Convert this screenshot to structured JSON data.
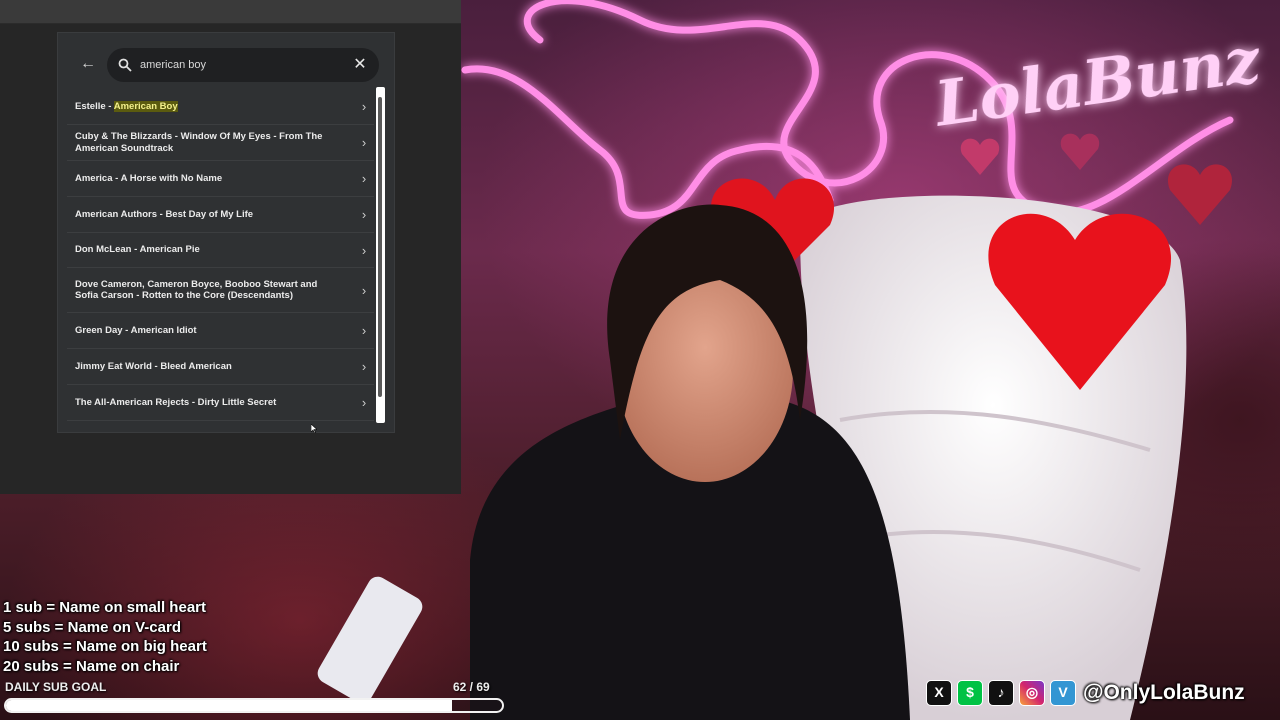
{
  "overlay": {
    "search_query": "american boy",
    "results": [
      {
        "prefix": "Estelle - ",
        "highlight": "American Boy",
        "suffix": ""
      },
      {
        "prefix": "Cuby & The Blizzards - Window Of My Eyes - From The American Soundtrack",
        "highlight": "",
        "suffix": ""
      },
      {
        "prefix": "America - A Horse with No Name",
        "highlight": "",
        "suffix": ""
      },
      {
        "prefix": "American Authors - Best Day of My Life",
        "highlight": "",
        "suffix": ""
      },
      {
        "prefix": "Don McLean - American Pie",
        "highlight": "",
        "suffix": ""
      },
      {
        "prefix": "Dove Cameron, Cameron Boyce, Booboo Stewart and Sofia Carson - Rotten to the Core (Descendants)",
        "highlight": "",
        "suffix": ""
      },
      {
        "prefix": "Green Day - American Idiot",
        "highlight": "",
        "suffix": ""
      },
      {
        "prefix": "Jimmy Eat World - Bleed American",
        "highlight": "",
        "suffix": ""
      },
      {
        "prefix": "The All-American Rejects - Dirty Little Secret",
        "highlight": "",
        "suffix": ""
      }
    ]
  },
  "neon_sign": "LolaBunz",
  "sub_rules": [
    "1 sub = Name on small heart",
    "5 subs = Name on V-card",
    "10 subs = Name on big heart",
    "20 subs = Name on chair"
  ],
  "goal": {
    "label": "DAILY SUB GOAL",
    "count": "62 / 69",
    "current": 62,
    "target": 69
  },
  "socials": {
    "icons": [
      "x-icon",
      "cashapp-icon",
      "tiktok-icon",
      "instagram-icon",
      "venmo-icon"
    ],
    "icon_glyphs": [
      "X",
      "$",
      "♪",
      "◎",
      "V"
    ],
    "handle": "@OnlyLolaBunz"
  },
  "colors": {
    "neon_pink": "#ff7adf",
    "highlight_bg": "#5b5b0f",
    "highlight_text": "#f3f08c"
  }
}
